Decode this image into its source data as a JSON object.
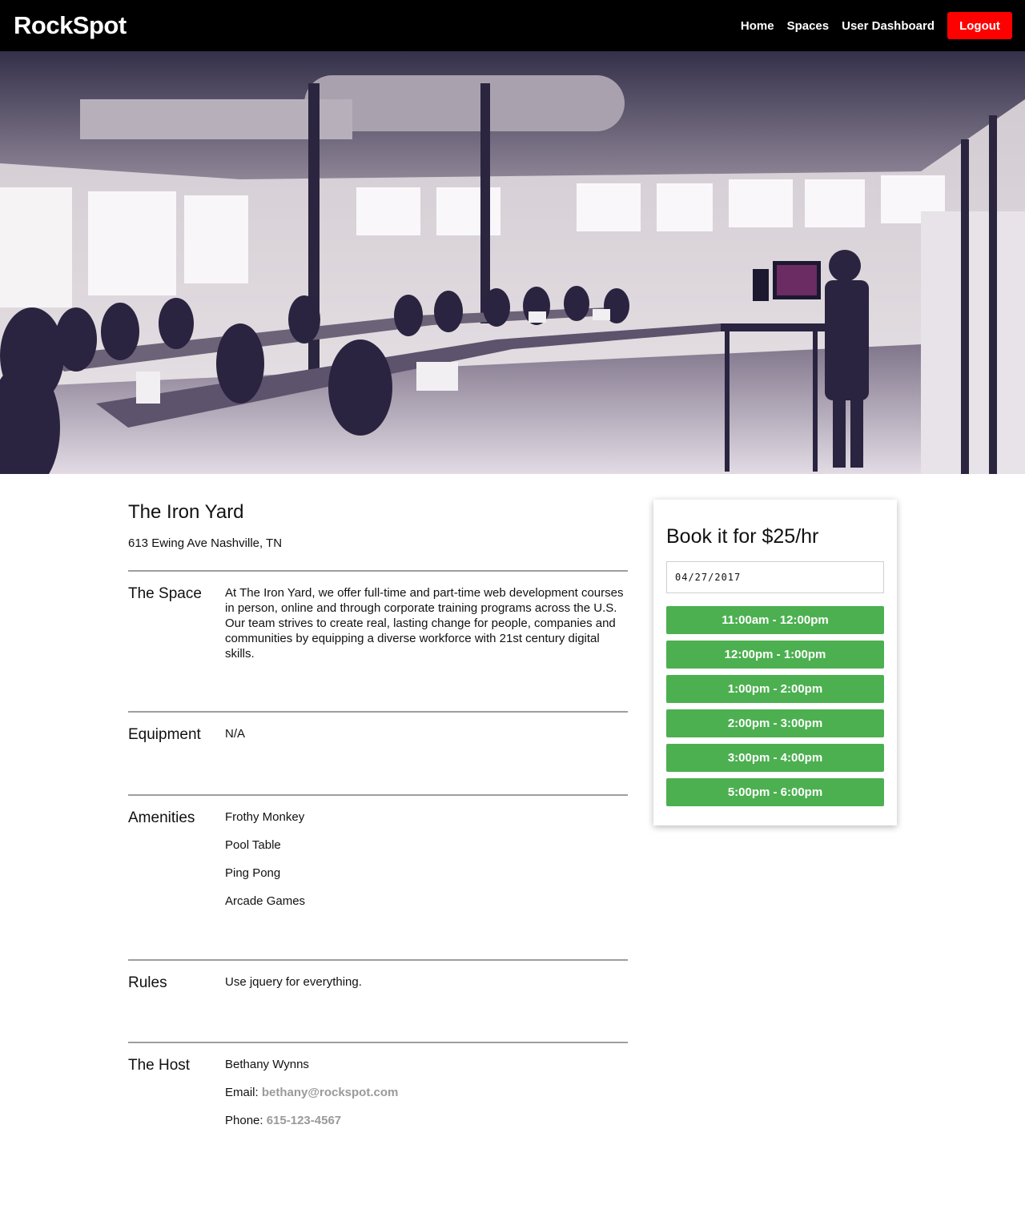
{
  "nav": {
    "brand": "RockSpot",
    "links": [
      "Home",
      "Spaces",
      "User Dashboard"
    ],
    "logout": "Logout"
  },
  "space": {
    "title": "The Iron Yard",
    "address": "613 Ewing Ave Nashville, TN"
  },
  "sections": {
    "space": {
      "label": "The Space",
      "text": "At The Iron Yard, we offer full-time and part-time web development courses in person, online and through corporate training programs across the U.S. Our team strives to create real, lasting change for people, companies and communities by equipping a diverse workforce with 21st century digital skills."
    },
    "equipment": {
      "label": "Equipment",
      "text": "N/A"
    },
    "amenities": {
      "label": "Amenities",
      "items": [
        "Frothy Monkey",
        "Pool Table",
        "Ping Pong",
        "Arcade Games"
      ]
    },
    "rules": {
      "label": "Rules",
      "text": "Use jquery for everything."
    },
    "host": {
      "label": "The Host",
      "name": "Bethany Wynns",
      "email_label": "Email:",
      "email": "bethany@rockspot.com",
      "phone_label": "Phone:",
      "phone": "615-123-4567"
    }
  },
  "booking": {
    "title": "Book it for $25/hr",
    "date": "04/27/2017",
    "slots": [
      "11:00am - 12:00pm",
      "12:00pm - 1:00pm",
      "1:00pm - 2:00pm",
      "2:00pm - 3:00pm",
      "3:00pm - 4:00pm",
      "5:00pm - 6:00pm"
    ]
  },
  "colors": {
    "nav_bg": "#000000",
    "logout_bg": "#ff0000",
    "slot_bg": "#4cb050",
    "muted_link": "#9a9a9a"
  }
}
